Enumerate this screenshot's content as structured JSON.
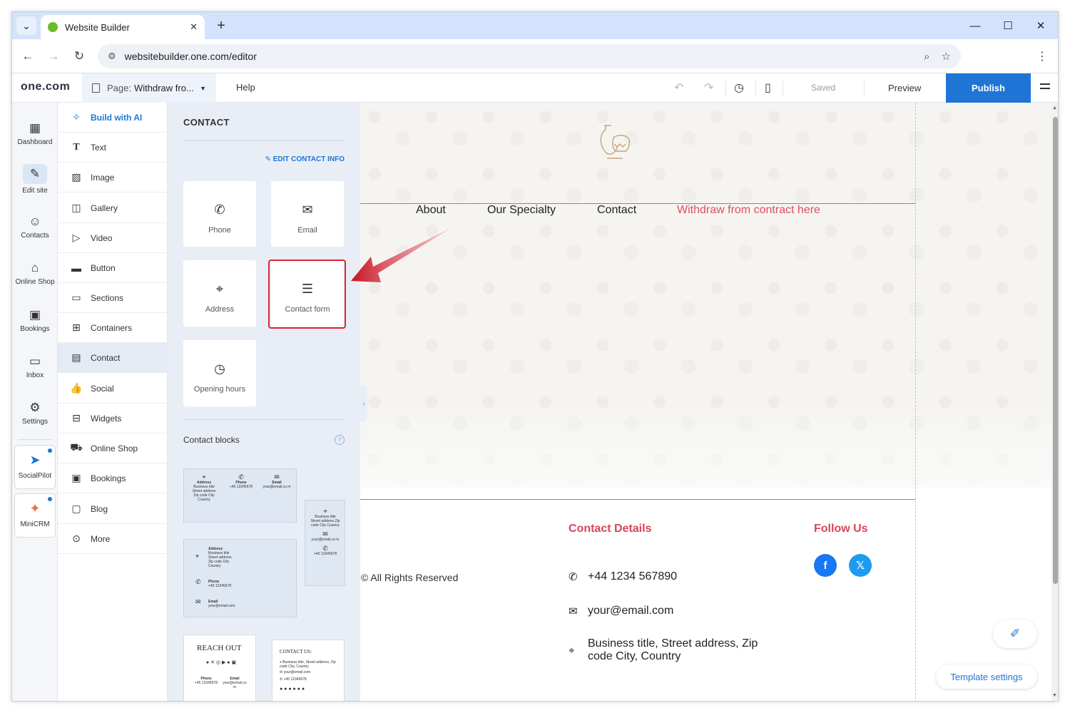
{
  "browser": {
    "tab_title": "Website Builder",
    "tab_close": "✕",
    "new_tab": "+",
    "url": "websitebuilder.one.com/editor",
    "icons": {
      "menu": "chevron-down-icon",
      "back": "back-arrow-icon",
      "forward": "forward-arrow-icon",
      "reload": "reload-icon",
      "site_info": "tune-icon",
      "zoom": "zoom-icon",
      "bookmark": "star-icon",
      "more": "kebab-icon"
    }
  },
  "editor": {
    "logo": "one.com",
    "page_label": "Page:",
    "page_value": "Withdraw fro...",
    "help": "Help",
    "saved": "Saved",
    "preview": "Preview",
    "publish": "Publish",
    "accent_color": "#1f75d6"
  },
  "rail": {
    "items": [
      {
        "label": "Dashboard",
        "icon": "grid-icon"
      },
      {
        "label": "Edit site",
        "icon": "edit-site-icon"
      },
      {
        "label": "Contacts",
        "icon": "contacts-icon"
      },
      {
        "label": "Online Shop",
        "icon": "shop-icon"
      },
      {
        "label": "Bookings",
        "icon": "calendar-icon"
      },
      {
        "label": "Inbox",
        "icon": "inbox-icon"
      },
      {
        "label": "Settings",
        "icon": "gear-icon"
      }
    ],
    "apps": [
      {
        "label": "SocialPilot",
        "icon": "socialpilot-icon"
      },
      {
        "label": "MiniCRM",
        "icon": "minicrm-icon"
      }
    ]
  },
  "elements": {
    "items": [
      {
        "label": "Build with AI",
        "icon": "sparkle-icon"
      },
      {
        "label": "Text",
        "icon": "text-icon"
      },
      {
        "label": "Image",
        "icon": "image-icon"
      },
      {
        "label": "Gallery",
        "icon": "gallery-icon"
      },
      {
        "label": "Video",
        "icon": "video-icon"
      },
      {
        "label": "Button",
        "icon": "button-icon"
      },
      {
        "label": "Sections",
        "icon": "sections-icon"
      },
      {
        "label": "Containers",
        "icon": "containers-icon"
      },
      {
        "label": "Contact",
        "icon": "contact-icon"
      },
      {
        "label": "Social",
        "icon": "thumb-icon"
      },
      {
        "label": "Widgets",
        "icon": "widgets-icon"
      },
      {
        "label": "Online Shop",
        "icon": "cart-icon"
      },
      {
        "label": "Bookings",
        "icon": "bookings-icon"
      },
      {
        "label": "Blog",
        "icon": "blog-icon"
      },
      {
        "label": "More",
        "icon": "more-icon"
      }
    ]
  },
  "contact_panel": {
    "title": "CONTACT",
    "edit_info": "EDIT CONTACT INFO",
    "cards": [
      {
        "label": "Phone",
        "icon": "phone-icon"
      },
      {
        "label": "Email",
        "icon": "mail-icon"
      },
      {
        "label": "Address",
        "icon": "pin-icon"
      },
      {
        "label": "Contact form",
        "icon": "form-icon"
      },
      {
        "label": "Opening hours",
        "icon": "clock-icon"
      }
    ],
    "blocks_title": "Contact blocks",
    "blocks_help": "?",
    "block1": {
      "address_label": "Address",
      "address_lines": "Business title Street address Zip code City Country",
      "phone_label": "Phone",
      "phone_value": "+45 12345678",
      "email_label": "Email",
      "email_value": "your@email.co m"
    },
    "block2": {
      "address_label": "Address",
      "address_lines": "Business title Street address Zip code City Country",
      "phone_label": "Phone",
      "phone_value": "+45 12345678",
      "email_label": "Email",
      "email_value": "your@email.com"
    },
    "block3": {
      "address_lines": "Business title Street address Zip code City Country",
      "email_value": "your@email.co m",
      "phone_value": "+45 12345678"
    },
    "block4": {
      "title": "REACH OUT",
      "phone_label": "Phone",
      "phone_value": "+45 12345678",
      "email_label": "Email",
      "email_value": "your@email.co m"
    },
    "block5": {
      "title": "CONTACT US:",
      "address_line": "Business title, Street address, Zip code City, Country",
      "email_value": "your@email.com",
      "phone_value": "+45 12345678"
    }
  },
  "site": {
    "nav": [
      "About",
      "Our Specialty",
      "Contact",
      "Withdraw from contract here"
    ],
    "nav_accent_color": "#e0505a",
    "rights": "© All Rights Reserved",
    "contact_heading": "Contact Details",
    "follow_heading": "Follow Us",
    "phone": "+44 1234 567890",
    "email": "your@email.com",
    "address_line1": "Business title, Street address, Zip",
    "address_line2": "code City, Country",
    "heading_color": "#d9445a",
    "social": [
      {
        "label": "f",
        "icon": "facebook-icon",
        "color": "#1877f2"
      },
      {
        "label": "𝕏",
        "icon": "x-icon",
        "color": "#1d9bf0"
      }
    ],
    "template_settings": "Template settings"
  }
}
